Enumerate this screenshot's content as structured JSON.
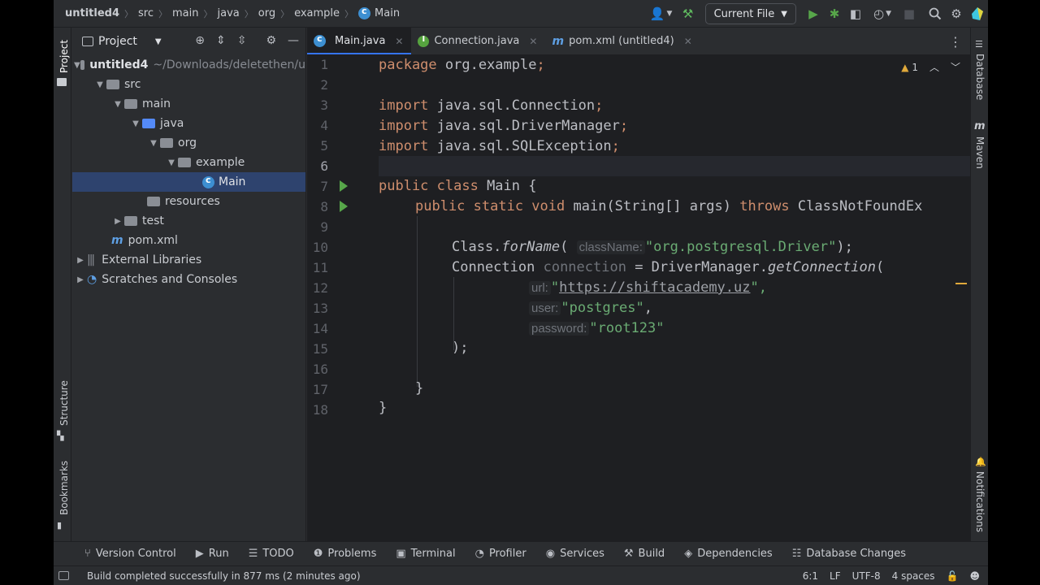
{
  "breadcrumbs": [
    "untitled4",
    "src",
    "main",
    "java",
    "org",
    "example",
    "Main"
  ],
  "toolbar": {
    "run_config": "Current File",
    "icons": [
      "account-icon",
      "build-hammer-icon",
      "run-icon",
      "debug-icon",
      "coverage-icon",
      "profile-icon",
      "stop-icon",
      "search-icon",
      "settings-icon",
      "jetbrains-logo-icon"
    ]
  },
  "left_stripe": {
    "project": "Project",
    "structure": "Structure",
    "bookmarks": "Bookmarks"
  },
  "right_stripe": {
    "database": "Database",
    "maven": "Maven",
    "notifications": "Notifications"
  },
  "project_panel": {
    "title": "Project",
    "tree": [
      {
        "label": "untitled4",
        "extra": "~/Downloads/deletethen/u",
        "level": 0,
        "expanded": true,
        "kind": "module"
      },
      {
        "label": "src",
        "level": 1,
        "expanded": true,
        "kind": "folder"
      },
      {
        "label": "main",
        "level": 2,
        "expanded": true,
        "kind": "folder"
      },
      {
        "label": "java",
        "level": 3,
        "expanded": true,
        "kind": "folder-blue"
      },
      {
        "label": "org",
        "level": 4,
        "expanded": true,
        "kind": "package"
      },
      {
        "label": "example",
        "level": 5,
        "expanded": true,
        "kind": "package"
      },
      {
        "label": "Main",
        "level": 6,
        "kind": "class",
        "selected": true
      },
      {
        "label": "resources",
        "level": 3,
        "kind": "folder-res"
      },
      {
        "label": "test",
        "level": 2,
        "collapsed": true,
        "kind": "folder"
      },
      {
        "label": "pom.xml",
        "level": 1,
        "kind": "maven"
      },
      {
        "label": "External Libraries",
        "level": 0,
        "collapsed": true,
        "kind": "libs"
      },
      {
        "label": "Scratches and Consoles",
        "level": 0,
        "collapsed": true,
        "kind": "scratches"
      }
    ]
  },
  "tabs": [
    {
      "label": "Main.java",
      "active": true,
      "icon": "java-class-icon"
    },
    {
      "label": "Connection.java",
      "active": false,
      "icon": "interface-icon"
    },
    {
      "label": "pom.xml (untitled4)",
      "active": false,
      "icon": "maven-icon"
    }
  ],
  "editor": {
    "warnings_count": "1",
    "line_numbers": [
      "1",
      "2",
      "3",
      "4",
      "5",
      "6",
      "7",
      "8",
      "9",
      "10",
      "11",
      "12",
      "13",
      "14",
      "15",
      "16",
      "17",
      "18"
    ],
    "current_line": 6,
    "code": {
      "l1_kw": "package",
      "l1_rest": " org.example",
      "l1_semi": ";",
      "l3_kw": "import",
      "l3_rest": " java.sql.Connection",
      "l3_semi": ";",
      "l4_kw": "import",
      "l4_rest": " java.sql.DriverManager",
      "l4_semi": ";",
      "l5_kw": "import",
      "l5_rest": " java.sql.SQLException",
      "l5_semi": ";",
      "l7_kw": "public class",
      "l7_rest": " Main {",
      "l8_kw": "public static void",
      "l8_fn": "main",
      "l8_mid": "(String[] args) ",
      "l8_kw2": "throws",
      "l8_rest": " ClassNotFoundEx",
      "l10_a": "Class.",
      "l10_fn": "forName",
      "l10_b": "( ",
      "l10_hint": "className:",
      "l10_str": "\"org.postgresql.Driver\"",
      "l10_end": ");",
      "l11_a": "Connection ",
      "l11_var": "connection",
      "l11_b": " = DriverManager.",
      "l11_fn": "getConnection",
      "l11_end": "(",
      "l12_hint": "url:",
      "l12_q1": "\"",
      "l12_url": "https://shiftacademy.uz",
      "l12_q2": "\",",
      "l13_hint": "user:",
      "l13_str": "\"postgres\"",
      "l13_end": ",",
      "l14_hint": "password:",
      "l14_str": "\"root123\"",
      "l15": ");",
      "l17": "}",
      "l18": "}"
    }
  },
  "bottom_tools": [
    {
      "label": "Version Control",
      "icon": "vcs-icon"
    },
    {
      "label": "Run",
      "icon": "run-icon"
    },
    {
      "label": "TODO",
      "icon": "todo-icon"
    },
    {
      "label": "Problems",
      "icon": "problems-icon"
    },
    {
      "label": "Terminal",
      "icon": "terminal-icon"
    },
    {
      "label": "Profiler",
      "icon": "profiler-icon"
    },
    {
      "label": "Services",
      "icon": "services-icon"
    },
    {
      "label": "Build",
      "icon": "build-icon"
    },
    {
      "label": "Dependencies",
      "icon": "dependencies-icon"
    },
    {
      "label": "Database Changes",
      "icon": "database-changes-icon"
    }
  ],
  "status": {
    "message": "Build completed successfully in 877 ms (2 minutes ago)",
    "position": "6:1",
    "line_sep": "LF",
    "encoding": "UTF-8",
    "indent": "4 spaces"
  }
}
